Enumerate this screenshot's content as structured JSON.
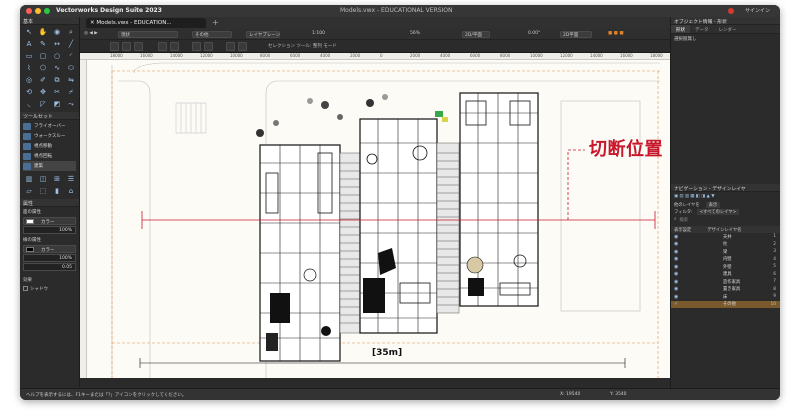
{
  "window": {
    "app_title": "Vectorworks Design Suite 2023",
    "doc_title": "Models.vwx - EDUCATIONAL VERSION",
    "user_label": "サインイン"
  },
  "tabs": [
    {
      "label": "Models.vwx - EDUCATION..."
    }
  ],
  "viewbar": {
    "class": "現状",
    "layer": "その他",
    "layer_plane": "レイヤプレーン",
    "scale": "1:100",
    "zoom": "56%",
    "view": "2D/平面",
    "angle": "0.00°",
    "render": "2D平面"
  },
  "modebar": {
    "hint": "セレクション ツール: 整列 モード"
  },
  "left": {
    "basic_palette": "基本",
    "toolsets_header": "ツールセット",
    "toolsets": [
      {
        "label": "フライオーバー"
      },
      {
        "label": "ウォークスルー"
      },
      {
        "label": "視点移動"
      },
      {
        "label": "視点回転"
      },
      {
        "label": "建築"
      }
    ],
    "attributes_header": "属性",
    "fill_label": "面の属性",
    "fill_value": "カラー",
    "fill_opacity": "100%",
    "line_label": "線の属性",
    "line_value": "カラー",
    "line_opacity": "100%",
    "line_thickness": "0.05",
    "effects_label": "効果",
    "shadow_label": "シャドウ"
  },
  "canvas": {
    "ruler_ticks": [
      "18000",
      "16000",
      "14000",
      "12000",
      "10000",
      "8000",
      "6000",
      "4000",
      "2000",
      "0",
      "2000",
      "4000",
      "6000",
      "8000",
      "10000",
      "12000",
      "14000",
      "16000",
      "18000"
    ],
    "callout": "切断位置",
    "dimension": "[35m]"
  },
  "status": {
    "help": "ヘルプを表示するには、F1キーまたは「?」アイコンをクリックしてください。",
    "x": "X: 19540",
    "y": "Y: 3540"
  },
  "right": {
    "obj_info_header": "オブジェクト情報 - 形状",
    "tabs": [
      "形状",
      "データ",
      "レンダー"
    ],
    "selection": "選択肢無し",
    "nav_header": "ナビゲーション - デザインレイヤ",
    "active_layer_label": "他のレイヤを",
    "active_layer_value": "表示",
    "filter_label": "フィルタ:",
    "filter_value": "<すべてのレイヤ>",
    "search_placeholder": "検索",
    "col_display": "表示設定",
    "col_name": "デザインレイヤ名",
    "layers": [
      {
        "name": "天井",
        "num": "1"
      },
      {
        "name": "柱",
        "num": "2"
      },
      {
        "name": "梁",
        "num": "3"
      },
      {
        "name": "内壁",
        "num": "4"
      },
      {
        "name": "外壁",
        "num": "5"
      },
      {
        "name": "建具",
        "num": "6"
      },
      {
        "name": "造作家具",
        "num": "7"
      },
      {
        "name": "置き家具",
        "num": "8"
      },
      {
        "name": "床",
        "num": "9"
      },
      {
        "name": "その他",
        "num": "10"
      }
    ]
  }
}
